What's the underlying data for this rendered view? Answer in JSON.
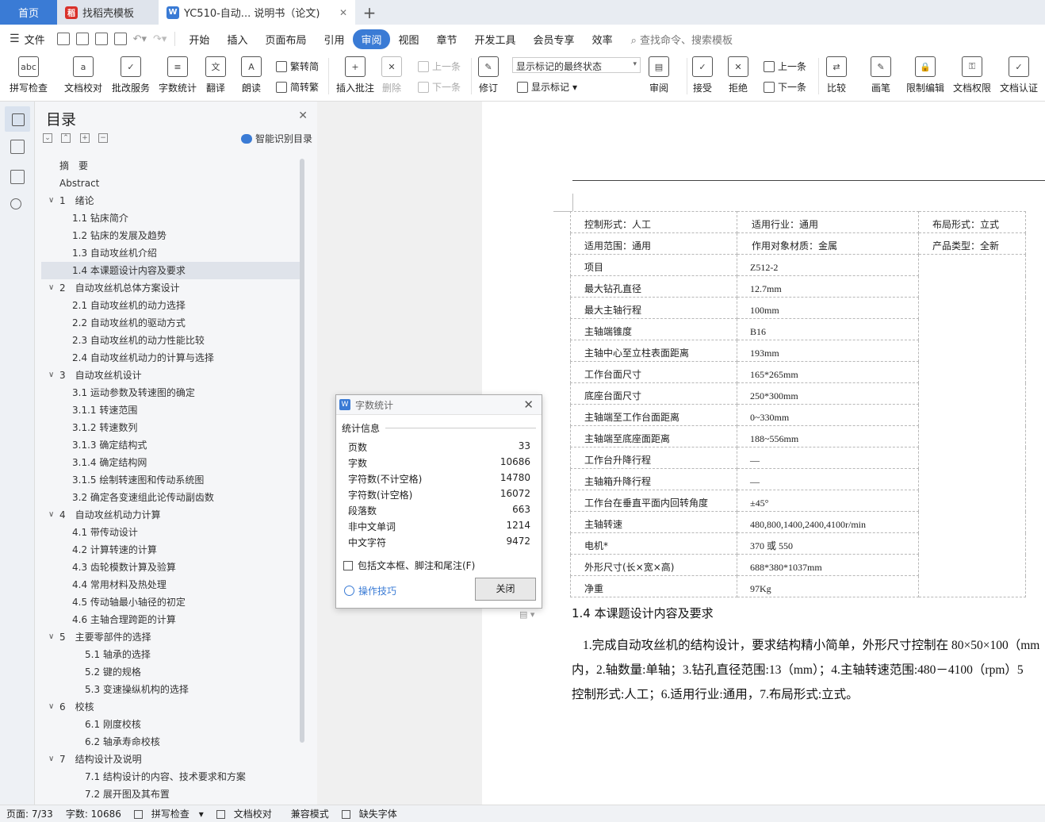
{
  "tabs": {
    "home": "首页",
    "template": "找稻壳模板",
    "doc": "YC510-自动... 说明书（论文)"
  },
  "menu": {
    "file": "文件",
    "items": [
      "开始",
      "插入",
      "页面布局",
      "引用",
      "审阅",
      "视图",
      "章节",
      "开发工具",
      "会员专享",
      "效率"
    ],
    "active": "审阅",
    "search": "查找命令、搜索模板"
  },
  "ribbon": {
    "spell": "拼写检查",
    "proof": "文档校对",
    "batch": "批改服务",
    "wordcount": "字数统计",
    "translate": "翻译",
    "read": "朗读",
    "to_trad": "繁转简",
    "to_simp": "简转繁",
    "insert_comment": "插入批注",
    "delete": "删除",
    "prev": "上一条",
    "next": "下一条",
    "revise": "修订",
    "markup_state": "显示标记的最终状态",
    "show_markup": "显示标记",
    "review": "审阅",
    "accept": "接受",
    "reject": "拒绝",
    "prev2": "上一条",
    "next2": "下一条",
    "compare": "比较",
    "pen": "画笔",
    "restrict": "限制编辑",
    "perm": "文档权限",
    "cert": "文档认证"
  },
  "toc": {
    "title": "目录",
    "smart": "智能识别目录",
    "items": [
      {
        "text": "摘　要",
        "level": 0
      },
      {
        "text": "Abstract",
        "level": 0
      },
      {
        "text": "1　绪论",
        "level": 1,
        "chev": true
      },
      {
        "text": "1.1  钻床简介",
        "level": 2
      },
      {
        "text": "1.2  钻床的发展及趋势",
        "level": 2
      },
      {
        "text": "1.3  自动攻丝机介绍",
        "level": 2
      },
      {
        "text": "1.4  本课题设计内容及要求",
        "level": 2,
        "sel": true
      },
      {
        "text": "2　自动攻丝机总体方案设计",
        "level": 1,
        "chev": true
      },
      {
        "text": "2.1  自动攻丝机的动力选择",
        "level": 2
      },
      {
        "text": "2.2  自动攻丝机的驱动方式",
        "level": 2
      },
      {
        "text": "2.3  自动攻丝机的动力性能比较",
        "level": 2
      },
      {
        "text": "2.4  自动攻丝机动力的计算与选择",
        "level": 2
      },
      {
        "text": "3　自动攻丝机设计",
        "level": 1,
        "chev": true
      },
      {
        "text": "3.1  运动参数及转速图的确定",
        "level": 2
      },
      {
        "text": "3.1.1 转速范围",
        "level": 2
      },
      {
        "text": "3.1.2 转速数列",
        "level": 2
      },
      {
        "text": "3.1.3 确定结构式",
        "level": 2
      },
      {
        "text": "3.1.4 确定结构网",
        "level": 2
      },
      {
        "text": "3.1.5 绘制转速图和传动系统图",
        "level": 2
      },
      {
        "text": "3.2  确定各变速组此论传动副齿数",
        "level": 2
      },
      {
        "text": "4　自动攻丝机动力计算",
        "level": 1,
        "chev": true
      },
      {
        "text": "4.1  带传动设计",
        "level": 2
      },
      {
        "text": "4.2  计算转速的计算",
        "level": 2
      },
      {
        "text": "4.3  齿轮模数计算及验算",
        "level": 2
      },
      {
        "text": "4.4  常用材料及热处理",
        "level": 2
      },
      {
        "text": "4.5  传动轴最小轴径的初定",
        "level": 2
      },
      {
        "text": "4.6  主轴合理跨距的计算",
        "level": 2
      },
      {
        "text": "5　主要零部件的选择",
        "level": 1,
        "chev": true
      },
      {
        "text": "5.1  轴承的选择",
        "level": 3
      },
      {
        "text": "5.2  键的规格",
        "level": 3
      },
      {
        "text": "5.3  变速操纵机构的选择",
        "level": 3
      },
      {
        "text": "6　校核",
        "level": 1,
        "chev": true
      },
      {
        "text": "6.1  刚度校核",
        "level": 3
      },
      {
        "text": "6.2  轴承寿命校核",
        "level": 3
      },
      {
        "text": "7　结构设计及说明",
        "level": 1,
        "chev": true
      },
      {
        "text": "7.1  结构设计的内容、技术要求和方案",
        "level": 3
      },
      {
        "text": "7.2  展开图及其布置",
        "level": 3
      }
    ]
  },
  "doc": {
    "header_rows": [
      [
        "控制形式：人工",
        "适用行业：通用",
        "布局形式：立式"
      ],
      [
        "适用范围：通用",
        "作用对象材质：金属",
        "产品类型：全新"
      ]
    ],
    "spec_rows": [
      [
        "项目",
        "Z512-2"
      ],
      [
        "最大钻孔直径",
        "12.7mm"
      ],
      [
        "最大主轴行程",
        "100mm"
      ],
      [
        "主轴端锥度",
        "B16"
      ],
      [
        "主轴中心至立柱表面距离",
        "193mm"
      ],
      [
        "工作台面尺寸",
        "165*265mm"
      ],
      [
        "底座台面尺寸",
        "250*300mm"
      ],
      [
        "主轴端至工作台面距离",
        "0~330mm"
      ],
      [
        "主轴端至底座面距离",
        "188~556mm"
      ],
      [
        "工作台升降行程",
        "—"
      ],
      [
        "主轴箱升降行程",
        "—"
      ],
      [
        "工作台在垂直平面内回转角度",
        "±45°"
      ],
      [
        "主轴转速",
        "480,800,1400,2400,4100r/min"
      ],
      [
        "电机*",
        "370 或 550"
      ],
      [
        "外形尺寸(长×宽×高)",
        "688*380*1037mm"
      ],
      [
        "净重",
        "97Kg"
      ]
    ],
    "section_heading": "1.4  本课题设计内容及要求",
    "para_lines": [
      "1.完成自动攻丝机的结构设计，要求结构精小简单，外形尺寸控制在 80×50×100（mm",
      "内，2.轴数量:单轴；3.钻孔直径范围:13（mm）；4.主轴转速范围:480－4100（rpm）5",
      "控制形式:人工；6.适用行业:通用，7.布局形式:立式。"
    ]
  },
  "dialog": {
    "title": "字数统计",
    "section": "统计信息",
    "rows": [
      {
        "label": "页数",
        "value": "33"
      },
      {
        "label": "字数",
        "value": "10686"
      },
      {
        "label": "字符数(不计空格)",
        "value": "14780"
      },
      {
        "label": "字符数(计空格)",
        "value": "16072"
      },
      {
        "label": "段落数",
        "value": "663"
      },
      {
        "label": "非中文单词",
        "value": "1214"
      },
      {
        "label": "中文字符",
        "value": "9472"
      }
    ],
    "checkbox": "包括文本框、脚注和尾注(F)",
    "tips": "操作技巧",
    "close": "关闭"
  },
  "status": {
    "page": "页面: 7/33",
    "words": "字数: 10686",
    "spell": "拼写检查",
    "proof": "文档校对",
    "compat": "兼容模式",
    "font": "缺失字体"
  },
  "colors": {
    "accent": "#3a7bd5",
    "wps_red": "#d9312a"
  }
}
